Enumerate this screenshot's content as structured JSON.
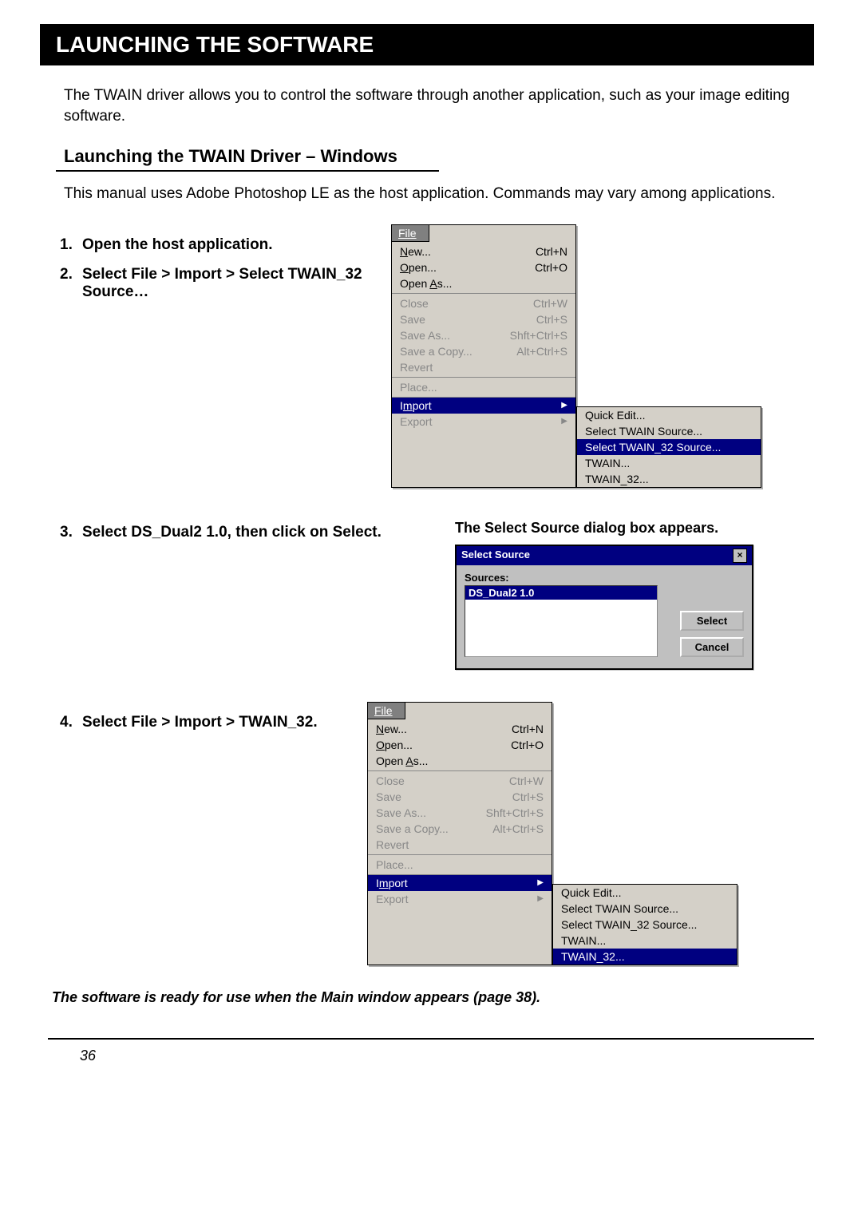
{
  "title": "LAUNCHING THE SOFTWARE",
  "intro": "The TWAIN driver allows you to control the software through another application, such as your image editing software.",
  "subheading": "Launching the TWAIN Driver – Windows",
  "subintro": "This manual uses Adobe Photoshop LE as the host application. Commands may vary among applications.",
  "steps": {
    "s1": {
      "num": "1.",
      "text": "Open the host application."
    },
    "s2": {
      "num": "2.",
      "text": "Select File > Import > Select TWAIN_32 Source…"
    },
    "s3": {
      "num": "3.",
      "text": "Select DS_Dual2 1.0, then click on Select."
    },
    "s4": {
      "num": "4.",
      "text": "Select File > Import > TWAIN_32."
    }
  },
  "dialog_caption": "The Select Source dialog box appears.",
  "file_menu": {
    "tab": "File",
    "new": "New...",
    "new_sc": "Ctrl+N",
    "open": "Open...",
    "open_sc": "Ctrl+O",
    "openas": "Open As...",
    "close": "Close",
    "close_sc": "Ctrl+W",
    "save": "Save",
    "save_sc": "Ctrl+S",
    "saveas": "Save As...",
    "saveas_sc": "Shft+Ctrl+S",
    "savecopy": "Save a Copy...",
    "savecopy_sc": "Alt+Ctrl+S",
    "revert": "Revert",
    "place": "Place...",
    "import": "Import",
    "export": "Export"
  },
  "submenu": {
    "quick": "Quick Edit...",
    "sel_twain": "Select TWAIN Source...",
    "sel_twain32": "Select TWAIN_32 Source...",
    "twain": "TWAIN...",
    "twain32": "TWAIN_32..."
  },
  "dialog": {
    "title": "Select Source",
    "sources_label": "Sources:",
    "item": "DS_Dual2 1.0",
    "select_btn": "Select",
    "cancel_btn": "Cancel",
    "close_x": "×"
  },
  "ready_note": "The software is ready for use when the Main window appears (page 38).",
  "page_number": "36"
}
